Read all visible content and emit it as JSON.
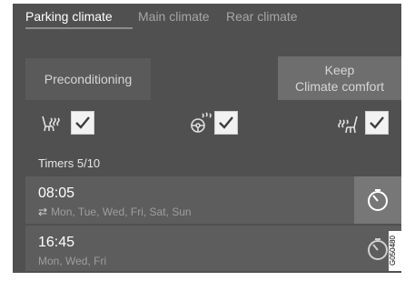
{
  "tabs": [
    {
      "label": "Parking climate",
      "active": true
    },
    {
      "label": "Main climate",
      "active": false
    },
    {
      "label": "Rear climate",
      "active": false
    }
  ],
  "buttons": {
    "preconditioning": "Preconditioning",
    "keep_line1": "Keep",
    "keep_line2": "Climate comfort"
  },
  "options": [
    {
      "icon": "seat-heating-icon",
      "checked": true
    },
    {
      "icon": "steering-wheel-heating-icon",
      "checked": true
    },
    {
      "icon": "rear-seat-heating-icon",
      "checked": true
    }
  ],
  "timers": {
    "title": "Timers 5/10",
    "items": [
      {
        "time": "08:05",
        "repeat_icon": "⇄",
        "days": "Mon, Tue, Wed, Fri, Sat, Sun"
      },
      {
        "time": "16:45",
        "days": "Mon, Wed, Fri"
      }
    ]
  },
  "side_code": "G050480",
  "colors": {
    "background": "#505050",
    "row": "#5d5d5d",
    "active_timer_btn": "#777777"
  }
}
